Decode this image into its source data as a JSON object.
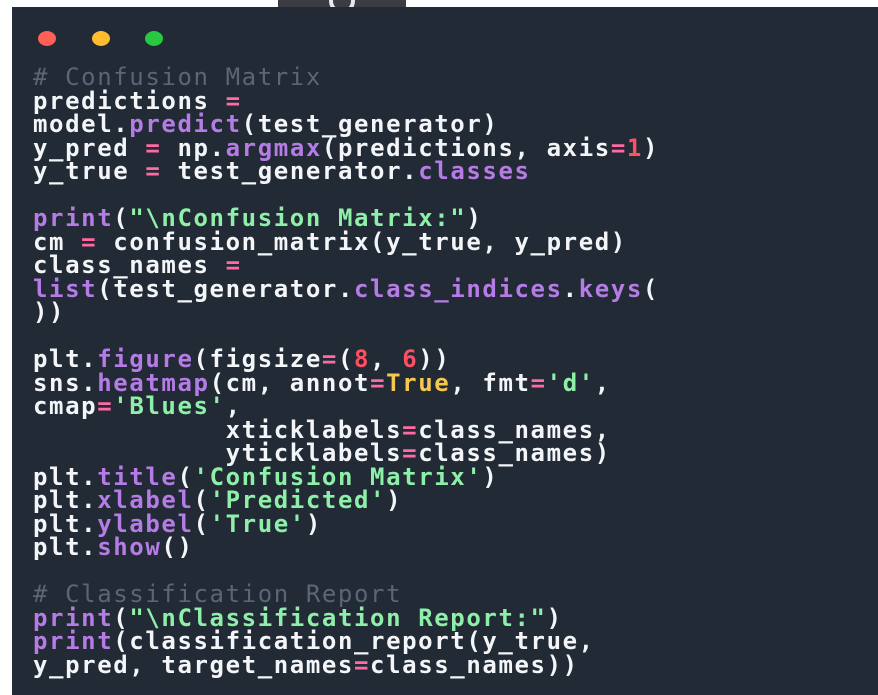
{
  "window": {
    "controls": [
      "close",
      "minimize",
      "maximize"
    ],
    "colors": {
      "background": "#222a35",
      "close": "#ff5f57",
      "minimize": "#febc2e",
      "maximize": "#28c840"
    }
  },
  "top_tab": {
    "icon": "reload-icon"
  },
  "code": {
    "lines": [
      [
        {
          "t": "# Confusion Matrix",
          "c": "comment"
        }
      ],
      [
        {
          "t": "predictions ",
          "c": "plain"
        },
        {
          "t": "=",
          "c": "op"
        }
      ],
      [
        {
          "t": "model.",
          "c": "plain"
        },
        {
          "t": "predict",
          "c": "fn"
        },
        {
          "t": "(test_generator)",
          "c": "plain"
        }
      ],
      [
        {
          "t": "y_pred ",
          "c": "plain"
        },
        {
          "t": "=",
          "c": "op"
        },
        {
          "t": " np.",
          "c": "plain"
        },
        {
          "t": "argmax",
          "c": "fn"
        },
        {
          "t": "(predictions, axis",
          "c": "plain"
        },
        {
          "t": "=",
          "c": "op"
        },
        {
          "t": "1",
          "c": "num"
        },
        {
          "t": ")",
          "c": "plain"
        }
      ],
      [
        {
          "t": "y_true ",
          "c": "plain"
        },
        {
          "t": "=",
          "c": "op"
        },
        {
          "t": " test_generator.",
          "c": "plain"
        },
        {
          "t": "classes",
          "c": "fn"
        }
      ],
      [],
      [
        {
          "t": "print",
          "c": "fn"
        },
        {
          "t": "(",
          "c": "plain"
        },
        {
          "t": "\"\\nConfusion Matrix:\"",
          "c": "str"
        },
        {
          "t": ")",
          "c": "plain"
        }
      ],
      [
        {
          "t": "cm ",
          "c": "plain"
        },
        {
          "t": "=",
          "c": "op"
        },
        {
          "t": " confusion_matrix(y_true, y_pred)",
          "c": "plain"
        }
      ],
      [
        {
          "t": "class_names ",
          "c": "plain"
        },
        {
          "t": "=",
          "c": "op"
        }
      ],
      [
        {
          "t": "list",
          "c": "fn"
        },
        {
          "t": "(test_generator.",
          "c": "plain"
        },
        {
          "t": "class_indices",
          "c": "fn"
        },
        {
          "t": ".",
          "c": "plain"
        },
        {
          "t": "keys",
          "c": "fn"
        },
        {
          "t": "(",
          "c": "plain"
        }
      ],
      [
        {
          "t": "))",
          "c": "plain"
        }
      ],
      [],
      [
        {
          "t": "plt.",
          "c": "plain"
        },
        {
          "t": "figure",
          "c": "fn"
        },
        {
          "t": "(figsize",
          "c": "plain"
        },
        {
          "t": "=",
          "c": "op"
        },
        {
          "t": "(",
          "c": "plain"
        },
        {
          "t": "8",
          "c": "num"
        },
        {
          "t": ", ",
          "c": "plain"
        },
        {
          "t": "6",
          "c": "num"
        },
        {
          "t": "))",
          "c": "plain"
        }
      ],
      [
        {
          "t": "sns.",
          "c": "plain"
        },
        {
          "t": "heatmap",
          "c": "fn"
        },
        {
          "t": "(cm, annot",
          "c": "plain"
        },
        {
          "t": "=",
          "c": "op"
        },
        {
          "t": "True",
          "c": "kw"
        },
        {
          "t": ", fmt",
          "c": "plain"
        },
        {
          "t": "=",
          "c": "op"
        },
        {
          "t": "'d'",
          "c": "str"
        },
        {
          "t": ",",
          "c": "plain"
        }
      ],
      [
        {
          "t": "cmap",
          "c": "plain"
        },
        {
          "t": "=",
          "c": "op"
        },
        {
          "t": "'Blues'",
          "c": "str"
        },
        {
          "t": ",",
          "c": "plain"
        }
      ],
      [
        {
          "t": "            xticklabels",
          "c": "plain"
        },
        {
          "t": "=",
          "c": "op"
        },
        {
          "t": "class_names,",
          "c": "plain"
        }
      ],
      [
        {
          "t": "            yticklabels",
          "c": "plain"
        },
        {
          "t": "=",
          "c": "op"
        },
        {
          "t": "class_names)",
          "c": "plain"
        }
      ],
      [
        {
          "t": "plt.",
          "c": "plain"
        },
        {
          "t": "title",
          "c": "fn"
        },
        {
          "t": "(",
          "c": "plain"
        },
        {
          "t": "'Confusion Matrix'",
          "c": "str"
        },
        {
          "t": ")",
          "c": "plain"
        }
      ],
      [
        {
          "t": "plt.",
          "c": "plain"
        },
        {
          "t": "xlabel",
          "c": "fn"
        },
        {
          "t": "(",
          "c": "plain"
        },
        {
          "t": "'Predicted'",
          "c": "str"
        },
        {
          "t": ")",
          "c": "plain"
        }
      ],
      [
        {
          "t": "plt.",
          "c": "plain"
        },
        {
          "t": "ylabel",
          "c": "fn"
        },
        {
          "t": "(",
          "c": "plain"
        },
        {
          "t": "'True'",
          "c": "str"
        },
        {
          "t": ")",
          "c": "plain"
        }
      ],
      [
        {
          "t": "plt.",
          "c": "plain"
        },
        {
          "t": "show",
          "c": "fn"
        },
        {
          "t": "()",
          "c": "plain"
        }
      ],
      [],
      [
        {
          "t": "# Classification Report",
          "c": "comment"
        }
      ],
      [
        {
          "t": "print",
          "c": "fn"
        },
        {
          "t": "(",
          "c": "plain"
        },
        {
          "t": "\"\\nClassification Report:\"",
          "c": "str"
        },
        {
          "t": ")",
          "c": "plain"
        }
      ],
      [
        {
          "t": "print",
          "c": "fn"
        },
        {
          "t": "(classification_report(y_true,",
          "c": "plain"
        }
      ],
      [
        {
          "t": "y_pred, target_names",
          "c": "plain"
        },
        {
          "t": "=",
          "c": "op"
        },
        {
          "t": "class_names))",
          "c": "plain"
        }
      ]
    ]
  }
}
